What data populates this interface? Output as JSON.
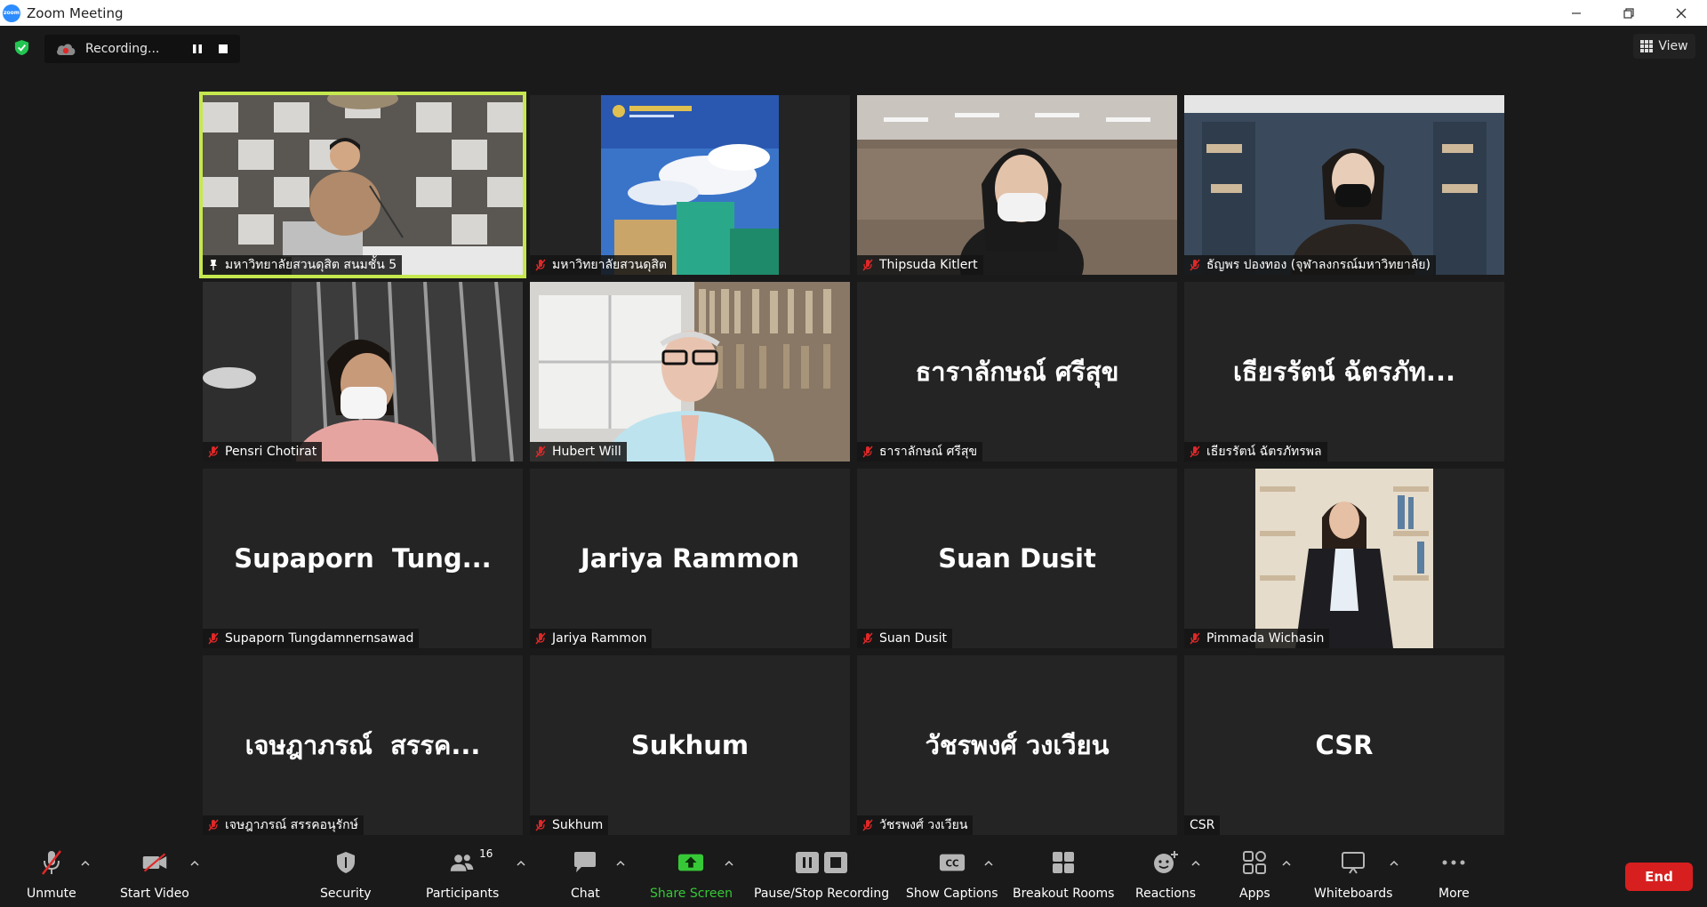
{
  "window": {
    "title": "Zoom Meeting",
    "logo_text": "zoom"
  },
  "recording": {
    "status_text": "Recording..."
  },
  "view_button": {
    "label": "View"
  },
  "tiles": [
    {
      "label": "มหาวิทยาลัยสวนดุสิต สนมชั้น 5",
      "big_name": "",
      "video": true
    },
    {
      "label": "มหาวิทยาลัยสวนดุสิต",
      "big_name": "",
      "video": true
    },
    {
      "label": "Thipsuda Kitlert",
      "big_name": "",
      "video": true
    },
    {
      "label": "ธัญพร ปองทอง (จุฬาลงกรณ์มหาวิทยาลัย)",
      "big_name": "",
      "video": true
    },
    {
      "label": "Pensri Chotirat",
      "big_name": "",
      "video": true
    },
    {
      "label": "Hubert Will",
      "big_name": "",
      "video": true
    },
    {
      "label": "ธาราลักษณ์ ศรีสุข",
      "big_name": "ธาราลักษณ์ ศรีสุข",
      "video": false
    },
    {
      "label": "เธียรรัตน์ ฉัตรภัทรพล",
      "big_name": "เธียรรัตน์ ฉัตรภัท...",
      "video": false
    },
    {
      "label": "Supaporn Tungdamnernsawad",
      "big_name": "Supaporn  Tung...",
      "video": false
    },
    {
      "label": "Jariya Rammon",
      "big_name": "Jariya Rammon",
      "video": false
    },
    {
      "label": "Suan Dusit",
      "big_name": "Suan Dusit",
      "video": false
    },
    {
      "label": "Pimmada Wichasin",
      "big_name": "",
      "video": true
    },
    {
      "label": "เจษฎาภรณ์ สรรคอนุรักษ์",
      "big_name": "เจษฎาภรณ์  สรรค...",
      "video": false
    },
    {
      "label": "Sukhum",
      "big_name": "Sukhum",
      "video": false
    },
    {
      "label": "วัชรพงศ์ วงเวียน",
      "big_name": "วัชรพงศ์ วงเวียน",
      "video": false
    },
    {
      "label": "CSR",
      "big_name": "CSR",
      "video": false
    }
  ],
  "toolbar": {
    "unmute": "Unmute",
    "start_video": "Start Video",
    "security": "Security",
    "participants": "Participants",
    "participants_count": "16",
    "chat": "Chat",
    "share_screen": "Share Screen",
    "pause_stop_recording": "Pause/Stop Recording",
    "show_captions": "Show Captions",
    "breakout_rooms": "Breakout Rooms",
    "reactions": "Reactions",
    "apps": "Apps",
    "whiteboards": "Whiteboards",
    "more": "More",
    "end": "End"
  },
  "colors": {
    "active_speaker_border": "#c5e84f",
    "share_green": "#37c837",
    "end_red": "#d81f1f",
    "mic_off_red": "#e02828"
  }
}
